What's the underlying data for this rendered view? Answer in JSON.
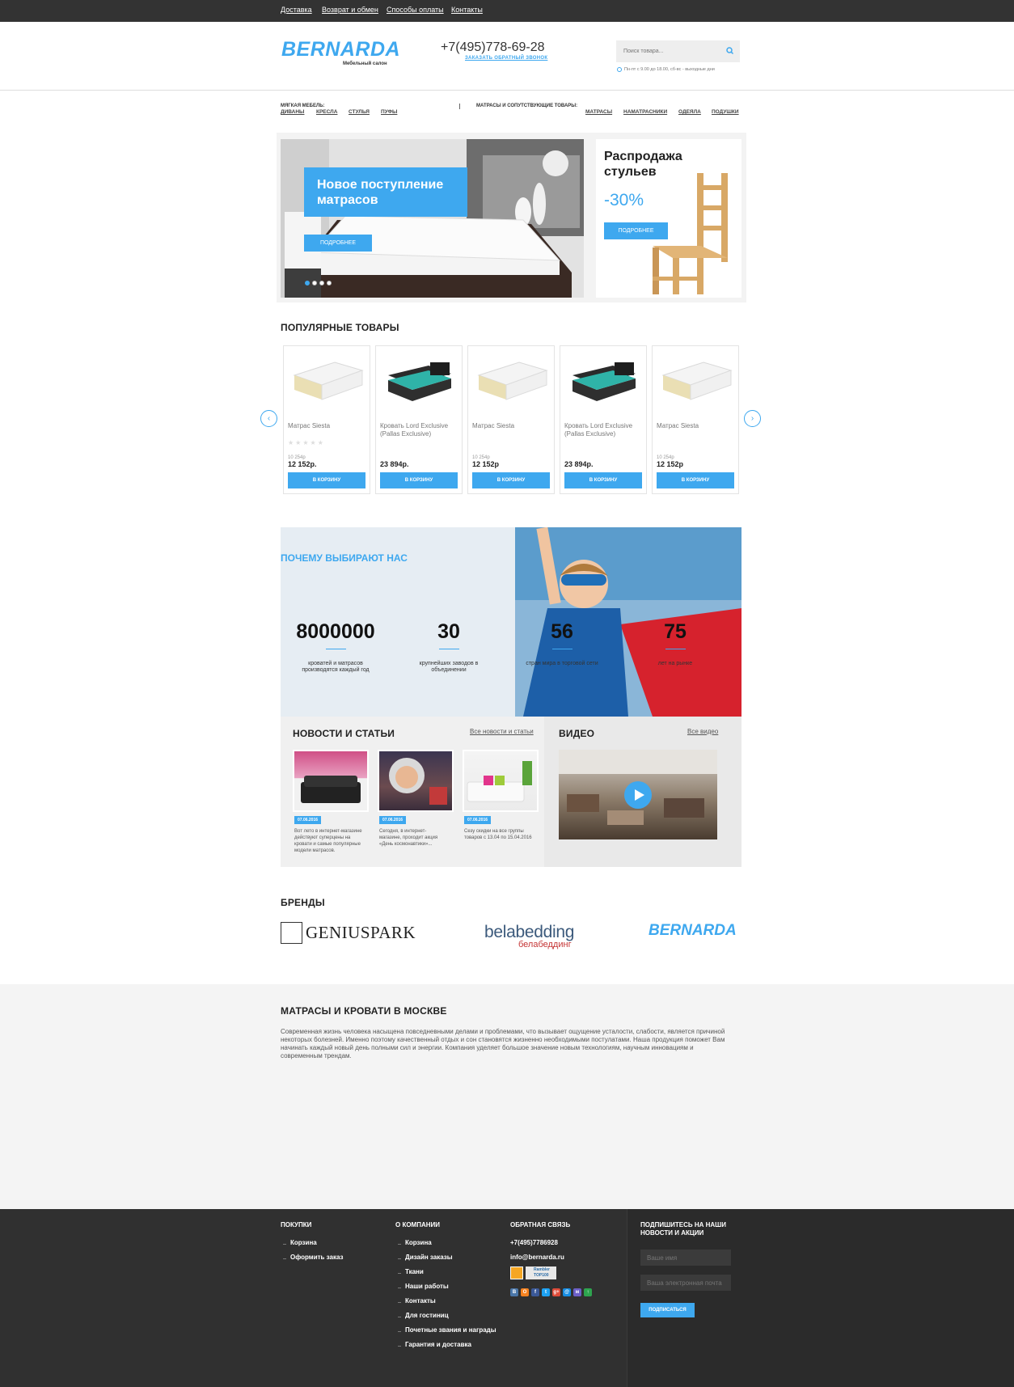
{
  "topnav": [
    "Доставка",
    "Возврат и обмен",
    "Способы оплаты",
    "Контакты"
  ],
  "header": {
    "logo": "BERNARDA",
    "logo_sub": "Мебельный салон",
    "phone": "+7(495)778-69-28",
    "callback": "ЗАКАЗАТЬ ОБРАТНЫЙ ЗВОНОК",
    "search_placeholder": "Поиск товара...",
    "hours": "Пн-пт с 9.00 до 18.00, сб-вс - выходные дни"
  },
  "categories": {
    "soft_title": "МЯГКАЯ МЕБЕЛЬ:",
    "soft_items": [
      "ДИВАНЫ",
      "КРЕСЛА",
      "СТУЛЬЯ",
      "ПУФЫ"
    ],
    "mattress_title": "МАТРАСЫ И СОПУТСТВУЮЩИЕ ТОВАРЫ:",
    "mattress_items": [
      "МАТРАСЫ",
      "НАМАТРАСНИКИ",
      "ОДЕЯЛА",
      "ПОДУШКИ"
    ]
  },
  "slider": {
    "title": "Новое поступление матрасов",
    "button": "ПОДРОБНЕЕ",
    "active_dot": 1,
    "dot_count": 4
  },
  "promo": {
    "title": "Распродажа стульев",
    "percent": "-30%",
    "button": "ПОДРОБНЕЕ"
  },
  "popular": {
    "title": "ПОПУЛЯРНЫЕ ТОВАРЫ",
    "button_label": "В КОРЗИНУ",
    "prev_arrow": "‹",
    "next_arrow": "›",
    "products": [
      {
        "name": "Матрас Siesta",
        "old_price": "10 254р",
        "price": "12 152р.",
        "kind": "mattress",
        "stars": "★★★★★"
      },
      {
        "name": "Кровать Lord Exclusive (Pallas Exclusive)",
        "old_price": "",
        "price": "23 894р.",
        "kind": "bed",
        "stars": ""
      },
      {
        "name": "Матрас Siesta",
        "old_price": "10 254р",
        "price": "12 152р",
        "kind": "mattress",
        "stars": ""
      },
      {
        "name": "Кровать Lord Exclusive (Pallas Exclusive)",
        "old_price": "",
        "price": "23 894р.",
        "kind": "bed",
        "stars": ""
      },
      {
        "name": "Матрас Siesta",
        "old_price": "10 254р",
        "price": "12 152р",
        "kind": "mattress",
        "stars": ""
      }
    ]
  },
  "why": {
    "title": "ПОЧЕМУ ВЫБИРАЮТ НАС",
    "stats": [
      {
        "value": "8000000",
        "text": "кроватей и матрасов производятся каждый год"
      },
      {
        "value": "30",
        "text": "крупнейших заводов в объединении"
      },
      {
        "value": "56",
        "text": "стран мира в торговой сети"
      },
      {
        "value": "75",
        "text": "лет на рынке"
      }
    ]
  },
  "news": {
    "title": "НОВОСТИ И СТАТЬИ",
    "all_link": "Все новости и статьи",
    "items": [
      {
        "date": "07.06.2016",
        "text": "Вот лето в интернет-магазине действуют суперцены на кровати и самые популярные модели матрасов."
      },
      {
        "date": "07.06.2016",
        "text": "Сегодня, в интернет-магазине, проходит акция «День космонавтики»..."
      },
      {
        "date": "07.06.2016",
        "text": "Сезу скидки на все группы товаров с 13.04 по 15.04.2016"
      }
    ]
  },
  "video": {
    "title": "ВИДЕО",
    "all_link": "Все видео"
  },
  "brands": {
    "title": "БРЕНДЫ",
    "geniuspark": "GENIUSPARK",
    "belabedding": "belabedding",
    "belabedding_sub": "белабеддинг",
    "bernarda": "BERNARDA"
  },
  "seo": {
    "title": "МАТРАСЫ И КРОВАТИ В МОСКВЕ",
    "text": "Современная жизнь человека насыщена повседневными делами и проблемами, что вызывает ощущение усталости, слабости, является причиной некоторых болезней. Именно поэтому качественный отдых и сон становятся жизненно необходимыми постулатами. Наша продукция поможет Вам начинать каждый новый день полными сил и энергии. Компания уделяет большое значение новым технологиям, научным инновациям и современным трендам."
  },
  "footer": {
    "purchases_title": "ПОКУПКИ",
    "purchases": [
      "Корзина",
      "Оформить заказ"
    ],
    "company_title": "О КОМПАНИИ",
    "company": [
      "Корзина",
      "Дизайн заказы",
      "Ткани",
      "Наши работы",
      "Контакты",
      "Для гостиниц",
      "Почетные звания и награды",
      "Гарантия и доставка"
    ],
    "contact_title": "ОБРАТНАЯ СВЯЗЬ",
    "contact_phone": "+7(495)7786928",
    "contact_email": "info@bernarda.ru",
    "rambler_label": "Rambler TOP100",
    "socials": [
      "В",
      "О",
      "f",
      "t",
      "g+",
      "@",
      "м",
      "↑"
    ],
    "subscribe_title": "ПОДПИШИТЕСЬ НА НАШИ НОВОСТИ И АКЦИИ",
    "name_placeholder": "Ваше имя",
    "email_placeholder": "Ваша электронная почта",
    "subscribe_button": "ПОДПИСАТЬСЯ"
  },
  "colors": {
    "accent": "#3ea8ef",
    "topbar": "#333333",
    "footer": "#303030"
  }
}
